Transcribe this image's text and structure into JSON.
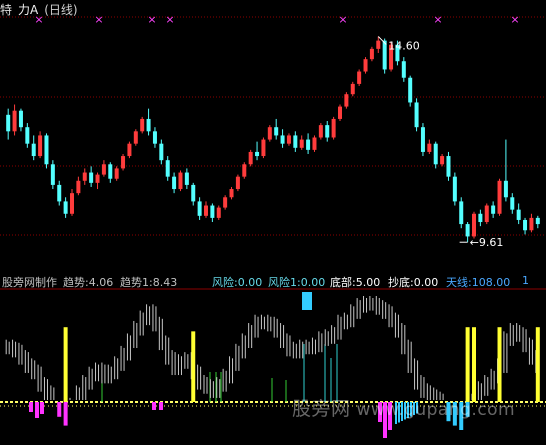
{
  "header": {
    "left_fragment": "特",
    "title": "力A",
    "period": "(日线)"
  },
  "indicator_bar": {
    "name": "股旁网制作",
    "items": [
      {
        "label": "趋势:",
        "value": "4.06",
        "color": "#c0c0c0"
      },
      {
        "label": "趋势1:",
        "value": "8.43",
        "color": "#c0c0c0"
      },
      {
        "label": "风险:",
        "value": "0.00",
        "color": "#66d9e8"
      },
      {
        "label": "风险1:",
        "value": "0.00",
        "color": "#66d9e8"
      },
      {
        "label": "底部:",
        "value": "5.00",
        "color": "#ffffff"
      },
      {
        "label": "抄底:",
        "value": "0.00",
        "color": "#ffffff"
      },
      {
        "label": "天线:",
        "value": "108.00",
        "color": "#4aa8ff"
      }
    ],
    "trailing_fragment": "1"
  },
  "watermark": {
    "text": "股旁网",
    "url": "www.gupang.com"
  },
  "colors": {
    "up": "#ff3c3c",
    "down": "#54ffff",
    "grid": "#8b0000",
    "marker": "#ff44ff",
    "trend_bar": "#c8c8c8",
    "signal_yellow": "#ffff33",
    "bottom_pink": "#ff33ff",
    "risk_cyan": "#33ccff",
    "green_line": "#33cc33",
    "baseline": "#ffff66"
  },
  "chart_data": {
    "type": "candlestick",
    "title": "",
    "annotations": [
      {
        "text": "14.60",
        "meaning": "period high"
      },
      {
        "text": "9.61",
        "meaning": "period low"
      }
    ],
    "y_range": [
      9.3,
      15.0
    ],
    "candles": [
      [
        12.7,
        12.85,
        12.1,
        12.3
      ],
      [
        12.3,
        12.95,
        12.2,
        12.8
      ],
      [
        12.8,
        12.85,
        12.3,
        12.4
      ],
      [
        12.4,
        12.5,
        11.9,
        12.0
      ],
      [
        12.0,
        12.2,
        11.6,
        11.7
      ],
      [
        11.7,
        12.3,
        11.65,
        12.2
      ],
      [
        12.2,
        12.25,
        11.4,
        11.5
      ],
      [
        11.5,
        11.6,
        10.9,
        11.0
      ],
      [
        11.0,
        11.1,
        10.5,
        10.6
      ],
      [
        10.6,
        10.7,
        10.2,
        10.3
      ],
      [
        10.3,
        10.9,
        10.25,
        10.8
      ],
      [
        10.8,
        11.2,
        10.75,
        11.1
      ],
      [
        11.1,
        11.4,
        11.0,
        11.3
      ],
      [
        11.3,
        11.45,
        10.95,
        11.05
      ],
      [
        11.05,
        11.3,
        10.9,
        11.25
      ],
      [
        11.25,
        11.6,
        11.2,
        11.5
      ],
      [
        11.5,
        11.55,
        11.05,
        11.15
      ],
      [
        11.15,
        11.45,
        11.1,
        11.4
      ],
      [
        11.4,
        11.75,
        11.35,
        11.7
      ],
      [
        11.7,
        12.05,
        11.65,
        12.0
      ],
      [
        12.0,
        12.35,
        11.95,
        12.3
      ],
      [
        12.3,
        12.65,
        12.25,
        12.6
      ],
      [
        12.6,
        12.85,
        12.2,
        12.3
      ],
      [
        12.3,
        12.4,
        11.9,
        12.0
      ],
      [
        12.0,
        12.1,
        11.5,
        11.6
      ],
      [
        11.6,
        11.7,
        11.1,
        11.2
      ],
      [
        11.2,
        11.3,
        10.8,
        10.9
      ],
      [
        10.9,
        11.35,
        10.85,
        11.3
      ],
      [
        11.3,
        11.4,
        10.9,
        11.0
      ],
      [
        11.0,
        11.05,
        10.5,
        10.6
      ],
      [
        10.6,
        10.7,
        10.15,
        10.25
      ],
      [
        10.25,
        10.6,
        10.2,
        10.5
      ],
      [
        10.5,
        10.55,
        10.1,
        10.2
      ],
      [
        10.2,
        10.5,
        10.15,
        10.45
      ],
      [
        10.45,
        10.75,
        10.4,
        10.7
      ],
      [
        10.7,
        10.95,
        10.65,
        10.9
      ],
      [
        10.9,
        11.25,
        10.85,
        11.2
      ],
      [
        11.2,
        11.55,
        11.15,
        11.5
      ],
      [
        11.5,
        11.85,
        11.45,
        11.8
      ],
      [
        11.8,
        12.05,
        11.6,
        11.7
      ],
      [
        11.7,
        12.15,
        11.65,
        12.1
      ],
      [
        12.1,
        12.45,
        12.05,
        12.4
      ],
      [
        12.4,
        12.6,
        12.1,
        12.2
      ],
      [
        12.2,
        12.35,
        11.9,
        12.0
      ],
      [
        12.0,
        12.25,
        11.95,
        12.2
      ],
      [
        12.2,
        12.3,
        11.8,
        11.9
      ],
      [
        11.9,
        12.2,
        11.85,
        12.1
      ],
      [
        12.1,
        12.25,
        11.75,
        11.85
      ],
      [
        11.85,
        12.2,
        11.8,
        12.15
      ],
      [
        12.15,
        12.5,
        12.1,
        12.45
      ],
      [
        12.45,
        12.55,
        12.05,
        12.15
      ],
      [
        12.15,
        12.65,
        12.1,
        12.6
      ],
      [
        12.6,
        12.95,
        12.55,
        12.9
      ],
      [
        12.9,
        13.25,
        12.85,
        13.2
      ],
      [
        13.2,
        13.5,
        13.15,
        13.45
      ],
      [
        13.45,
        13.8,
        13.4,
        13.75
      ],
      [
        13.75,
        14.1,
        13.7,
        14.05
      ],
      [
        14.05,
        14.35,
        14.0,
        14.3
      ],
      [
        14.3,
        14.6,
        14.2,
        14.5
      ],
      [
        14.5,
        14.55,
        13.7,
        13.8
      ],
      [
        13.8,
        14.45,
        13.75,
        14.4
      ],
      [
        14.4,
        14.5,
        13.9,
        14.0
      ],
      [
        14.0,
        14.1,
        13.5,
        13.6
      ],
      [
        13.6,
        13.65,
        12.9,
        13.0
      ],
      [
        13.0,
        13.1,
        12.3,
        12.4
      ],
      [
        12.4,
        12.5,
        11.7,
        11.8
      ],
      [
        11.8,
        12.1,
        11.75,
        12.0
      ],
      [
        12.0,
        12.05,
        11.4,
        11.5
      ],
      [
        11.5,
        11.75,
        11.45,
        11.7
      ],
      [
        11.7,
        11.8,
        11.1,
        11.2
      ],
      [
        11.2,
        11.3,
        10.5,
        10.6
      ],
      [
        10.6,
        10.7,
        9.95,
        10.05
      ],
      [
        10.05,
        10.1,
        9.61,
        9.75
      ],
      [
        9.75,
        10.35,
        9.7,
        10.3
      ],
      [
        10.3,
        10.4,
        10.0,
        10.1
      ],
      [
        10.1,
        10.55,
        10.05,
        10.5
      ],
      [
        10.5,
        10.6,
        10.2,
        10.3
      ],
      [
        10.3,
        11.15,
        10.25,
        11.1
      ],
      [
        11.1,
        12.1,
        10.6,
        10.7
      ],
      [
        10.7,
        10.8,
        10.3,
        10.4
      ],
      [
        10.4,
        10.55,
        10.05,
        10.15
      ],
      [
        10.15,
        10.2,
        9.8,
        9.9
      ],
      [
        9.9,
        10.3,
        9.85,
        10.2
      ],
      [
        10.2,
        10.25,
        9.95,
        10.05
      ]
    ],
    "trend_values": [
      58,
      55,
      48,
      40,
      34,
      22,
      14,
      6,
      -4,
      -8,
      2,
      14,
      24,
      32,
      36,
      30,
      34,
      42,
      52,
      64,
      76,
      86,
      92,
      80,
      62,
      48,
      38,
      44,
      46,
      34,
      24,
      20,
      16,
      22,
      30,
      42,
      54,
      64,
      74,
      82,
      82,
      80,
      74,
      64,
      56,
      54,
      58,
      58,
      60,
      66,
      68,
      72,
      82,
      84,
      92,
      98,
      100,
      100,
      96,
      92,
      84,
      74,
      58,
      40,
      24,
      16,
      12,
      8,
      4,
      -6,
      -8,
      -10,
      -4,
      6,
      18,
      24,
      30,
      40,
      66,
      74,
      70,
      60,
      48,
      40
    ],
    "signals": [
      {
        "index": 9,
        "type": "yellow",
        "value": 70
      },
      {
        "index": 29,
        "type": "yellow",
        "value": 66
      },
      {
        "index": 72,
        "type": "yellow",
        "value": 70
      },
      {
        "index": 73,
        "type": "yellow",
        "value": 70
      },
      {
        "index": 77,
        "type": "yellow",
        "value": 70
      },
      {
        "index": 83,
        "type": "yellow",
        "value": 70
      }
    ]
  }
}
